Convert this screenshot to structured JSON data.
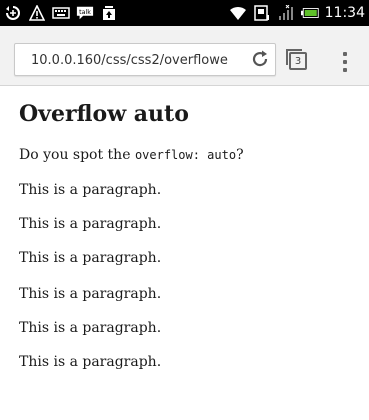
{
  "status_bar": {
    "time": "11:34",
    "icons": [
      "sync-icon",
      "warning-icon",
      "keyboard-icon",
      "talk-icon",
      "upload-icon",
      "wifi-icon",
      "nfc-icon",
      "signal-icon",
      "battery-icon"
    ],
    "talk_label": "talk"
  },
  "browser": {
    "url": "10.0.0.160/css/css2/overflowe",
    "tab_count": "3",
    "icons": [
      "reload-icon",
      "tabs-icon",
      "overflow-menu-icon"
    ]
  },
  "page": {
    "title": "Overflow auto",
    "question_prefix": "Do you spot the ",
    "question_code": "overflow: auto",
    "question_suffix": "?",
    "paragraphs": [
      "This is a paragraph.",
      "This is a paragraph.",
      "This is a paragraph.",
      "This is a paragraph.",
      "This is a paragraph.",
      "This is a paragraph."
    ]
  }
}
